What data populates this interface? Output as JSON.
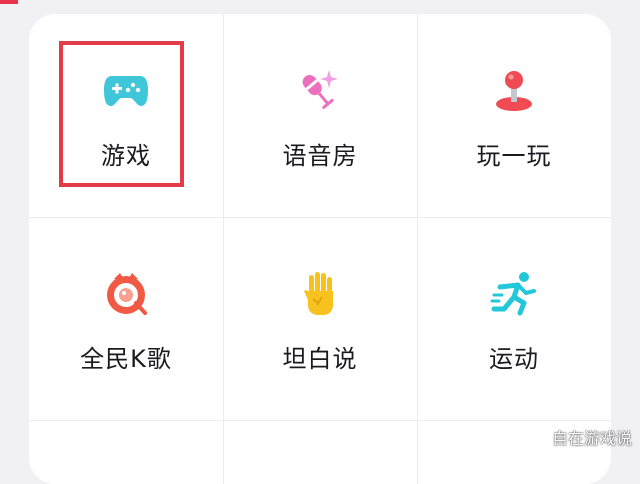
{
  "colors": {
    "highlight_box": "#e33b47",
    "accent_red": "#e8334a"
  },
  "tiles": [
    {
      "label": "游戏",
      "icon": "gamepad-icon"
    },
    {
      "label": "语音房",
      "icon": "microphone-icon"
    },
    {
      "label": "玩一玩",
      "icon": "joystick-icon"
    },
    {
      "label": "全民K歌",
      "icon": "karaoke-icon"
    },
    {
      "label": "坦白说",
      "icon": "hand-icon"
    },
    {
      "label": "运动",
      "icon": "running-icon"
    }
  ],
  "watermark": "自在游戏说"
}
